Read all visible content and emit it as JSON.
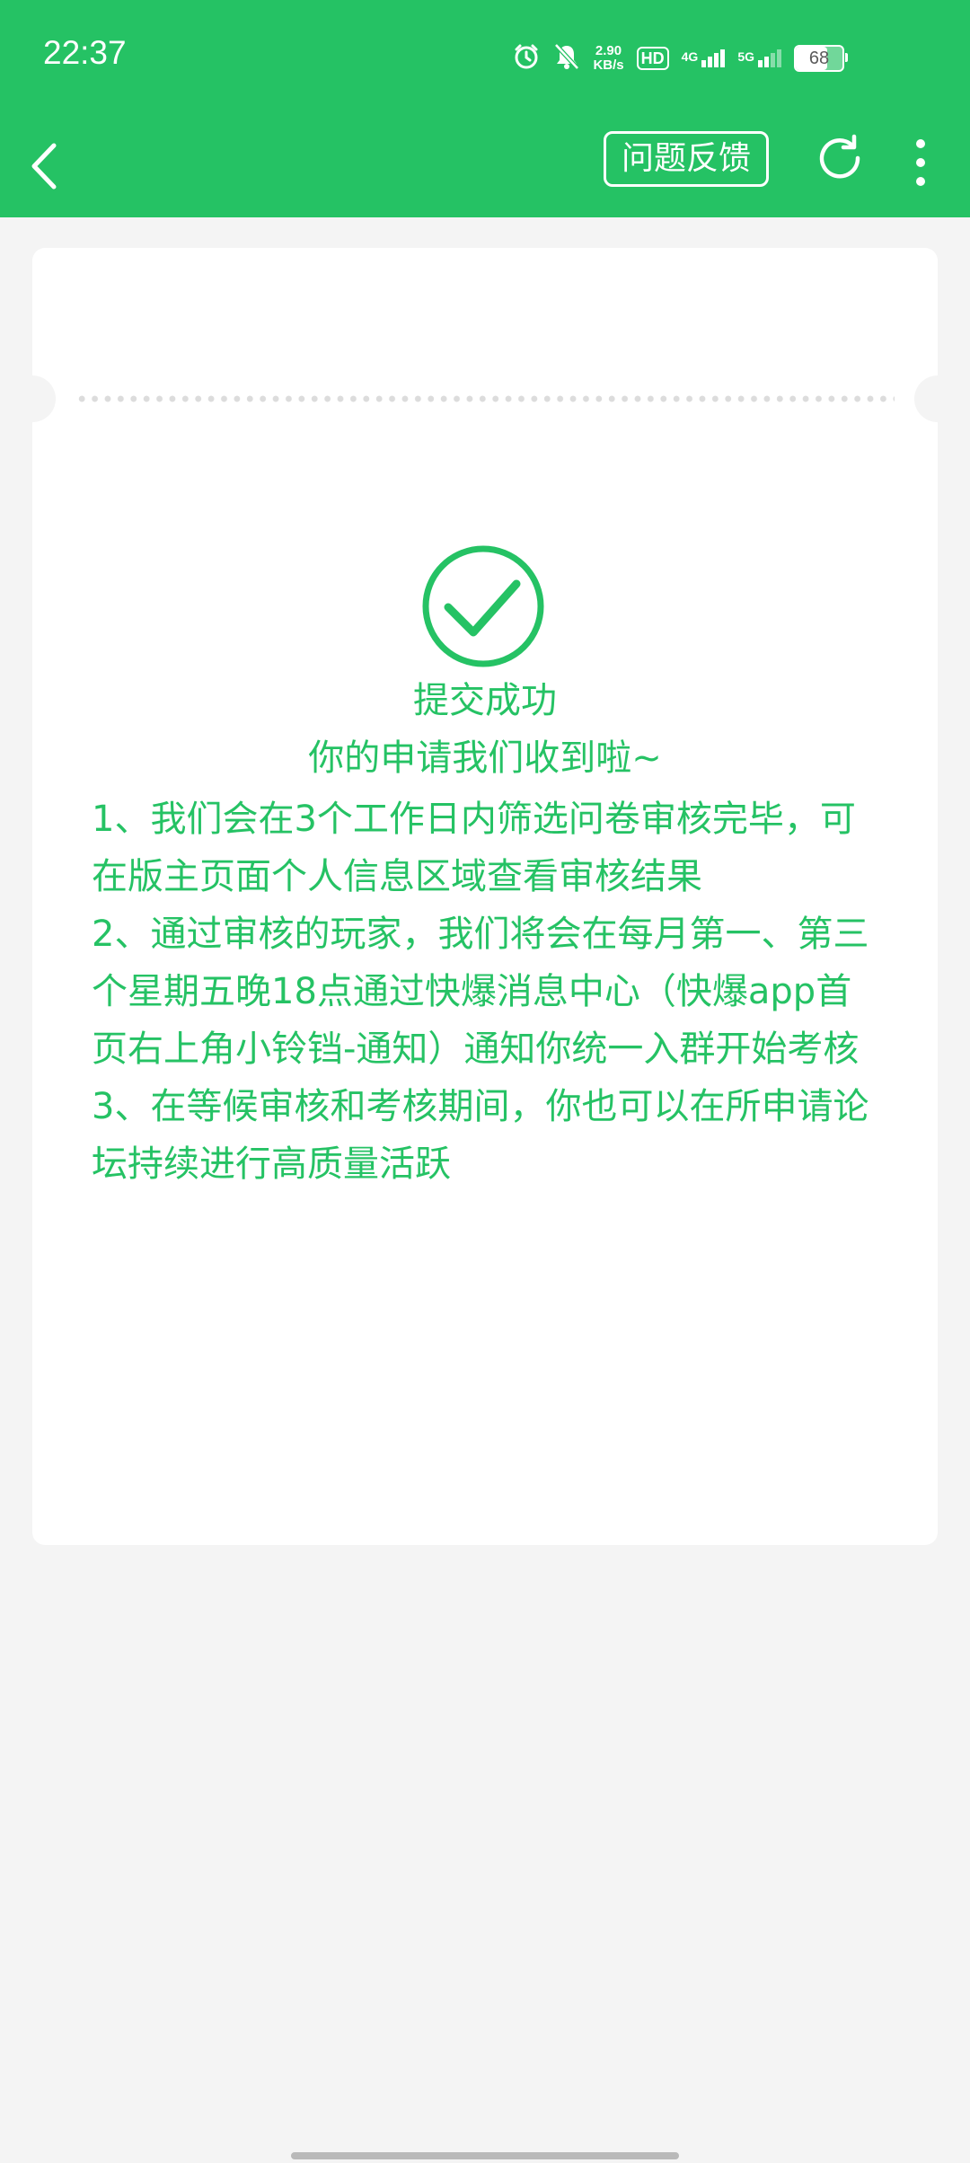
{
  "status_bar": {
    "time": "22:37",
    "net_speed_value": "2.90",
    "net_speed_unit": "KB/s",
    "hd_label": "HD",
    "sim1_label": "4G",
    "sim2_label": "5G",
    "battery_level": "68",
    "icons": [
      "alarm-icon",
      "mute-bell-icon",
      "signal-icon",
      "battery-icon"
    ]
  },
  "app_bar": {
    "feedback_label": "问题反馈",
    "icons": [
      "chevron-left-icon",
      "refresh-icon",
      "more-vertical-icon"
    ]
  },
  "result": {
    "title": "提交成功",
    "subtitle": "你的申请我们收到啦~",
    "notices": [
      "1、我们会在3个工作日内筛选问卷审核完毕，可在版主页面个人信息区域查看审核结果",
      "2、通过审核的玩家，我们将会在每月第一、第三个星期五晚18点通过快爆消息中心（快爆app首页右上角小铃铛-通知）通知你统一入群开始考核",
      "3、在等候审核和考核期间，你也可以在所申请论坛持续进行高质量活跃"
    ]
  },
  "colors": {
    "brand_green": "#25c264",
    "background": "#f4f4f4",
    "card": "#ffffff"
  }
}
